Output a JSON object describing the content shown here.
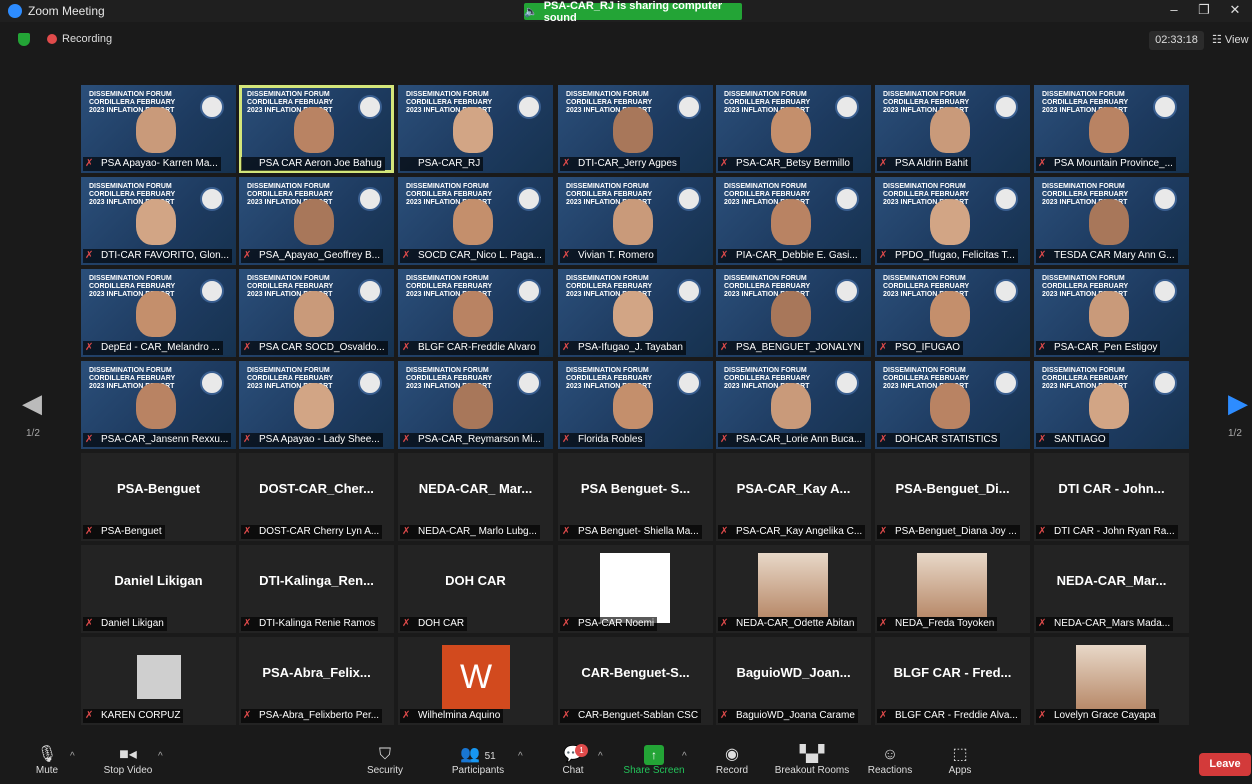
{
  "window": {
    "title": "Zoom Meeting",
    "share_banner": "PSA-CAR_RJ is sharing computer sound"
  },
  "status": {
    "recording": "Recording",
    "timer": "02:33:18",
    "view": "View"
  },
  "pagination": {
    "left": "1/2",
    "right": "1/2"
  },
  "tiles": [
    {
      "name": "PSA Apayao- Karren Ma...",
      "kind": "video",
      "muted": true
    },
    {
      "name": "PSA CAR Aeron Joe Bahug",
      "kind": "video",
      "muted": false,
      "active": true
    },
    {
      "name": "PSA-CAR_RJ",
      "kind": "video",
      "muted": false
    },
    {
      "name": "DTI-CAR_Jerry Agpes",
      "kind": "video",
      "muted": true
    },
    {
      "name": "PSA-CAR_Betsy Bermillo",
      "kind": "video",
      "muted": true
    },
    {
      "name": "PSA Aldrin Bahit",
      "kind": "video",
      "muted": true
    },
    {
      "name": "PSA Mountain Province_...",
      "kind": "video",
      "muted": true
    },
    {
      "name": "DTI-CAR FAVORITO, Glon...",
      "kind": "video",
      "muted": true
    },
    {
      "name": "PSA_Apayao_Geoffrey B...",
      "kind": "video",
      "muted": true
    },
    {
      "name": "SOCD CAR_Nico L. Paga...",
      "kind": "video",
      "muted": true
    },
    {
      "name": "Vivian T. Romero",
      "kind": "video",
      "muted": true
    },
    {
      "name": "PIA-CAR_Debbie E. Gasi...",
      "kind": "video",
      "muted": true
    },
    {
      "name": "PPDO_Ifugao, Felicitas T...",
      "kind": "video",
      "muted": true
    },
    {
      "name": "TESDA CAR Mary Ann G...",
      "kind": "video",
      "muted": true
    },
    {
      "name": "DepEd - CAR_Melandro ...",
      "kind": "video",
      "muted": true
    },
    {
      "name": "PSA CAR SOCD_Osvaldo...",
      "kind": "video",
      "muted": true
    },
    {
      "name": "BLGF CAR-Freddie Alvaro",
      "kind": "video",
      "muted": true
    },
    {
      "name": "PSA-Ifugao_J. Tayaban",
      "kind": "video",
      "muted": true
    },
    {
      "name": "PSA_BENGUET_JONALYN",
      "kind": "video",
      "muted": true
    },
    {
      "name": "PSO_IFUGAO",
      "kind": "video",
      "muted": true
    },
    {
      "name": "PSA-CAR_Pen Estigoy",
      "kind": "video",
      "muted": true
    },
    {
      "name": "PSA-CAR_Jansenn Rexxu...",
      "kind": "video",
      "muted": true
    },
    {
      "name": "PSA Apayao - Lady Shee...",
      "kind": "video",
      "muted": true
    },
    {
      "name": "PSA-CAR_Reymarson Mi...",
      "kind": "video",
      "muted": true
    },
    {
      "name": "Florida Robles",
      "kind": "video",
      "muted": true
    },
    {
      "name": "PSA-CAR_Lorie Ann Buca...",
      "kind": "video",
      "muted": true
    },
    {
      "name": "DOHCAR STATISTICS",
      "kind": "video",
      "muted": true
    },
    {
      "name": "SANTIAGO",
      "kind": "video",
      "muted": true
    },
    {
      "name": "PSA-Benguet",
      "big": "PSA-Benguet",
      "kind": "name",
      "muted": true
    },
    {
      "name": "DOST-CAR Cherry Lyn A...",
      "big": "DOST-CAR_Cher...",
      "kind": "name",
      "muted": true
    },
    {
      "name": "NEDA-CAR_ Marlo Lubg...",
      "big": "NEDA-CAR_ Mar...",
      "kind": "name",
      "muted": true
    },
    {
      "name": "PSA Benguet- Shiella Ma...",
      "big": "PSA Benguet- S...",
      "kind": "name",
      "muted": true
    },
    {
      "name": "PSA-CAR_Kay Angelika C...",
      "big": "PSA-CAR_Kay A...",
      "kind": "name",
      "muted": true
    },
    {
      "name": "PSA-Benguet_Diana Joy ...",
      "big": "PSA-Benguet_Di...",
      "kind": "name",
      "muted": true
    },
    {
      "name": "DTI CAR - John Ryan Ra...",
      "big": "DTI CAR - John...",
      "kind": "name",
      "muted": true
    },
    {
      "name": "Daniel Likigan",
      "big": "Daniel Likigan",
      "kind": "name",
      "muted": true
    },
    {
      "name": "DTI-Kalinga Renie Ramos",
      "big": "DTI-Kalinga_Ren...",
      "kind": "name",
      "muted": true
    },
    {
      "name": "DOH CAR",
      "big": "DOH CAR",
      "kind": "name",
      "muted": true
    },
    {
      "name": "PSA-CAR Noemi",
      "kind": "photo-white",
      "muted": true
    },
    {
      "name": "NEDA-CAR_Odette Abitan",
      "kind": "photo-face",
      "muted": true
    },
    {
      "name": "NEDA_Freda Toyoken",
      "kind": "photo-face",
      "muted": true
    },
    {
      "name": "NEDA-CAR_Mars Mada...",
      "big": "NEDA-CAR_Mar...",
      "kind": "name",
      "muted": true
    },
    {
      "name": "KAREN CORPUZ",
      "kind": "photo-default",
      "muted": true
    },
    {
      "name": "PSA-Abra_Felixberto Per...",
      "big": "PSA-Abra_Felix...",
      "kind": "name",
      "muted": true
    },
    {
      "name": "Wilhelmina Aquino",
      "kind": "letter",
      "letter": "W",
      "muted": true
    },
    {
      "name": "CAR-Benguet-Sablan CSC",
      "big": "CAR-Benguet-S...",
      "kind": "name",
      "muted": true
    },
    {
      "name": "BaguioWD_Joana Carame",
      "big": "BaguioWD_Joan...",
      "kind": "name",
      "muted": true
    },
    {
      "name": "BLGF CAR - Freddie Alva...",
      "big": "BLGF CAR - Fred...",
      "kind": "name",
      "muted": true
    },
    {
      "name": "Lovelyn Grace Cayapa",
      "kind": "photo-face",
      "muted": true
    }
  ],
  "banner_text": "DISSEMINATION FORUM CORDILLERA FEBRUARY 2023 INFLATION REPORT",
  "toolbar": {
    "mute": "Mute",
    "stop_video": "Stop Video",
    "security": "Security",
    "participants": "Participants",
    "participants_count": "51",
    "chat": "Chat",
    "chat_badge": "1",
    "share_screen": "Share Screen",
    "record": "Record",
    "breakout": "Breakout Rooms",
    "reactions": "Reactions",
    "apps": "Apps",
    "leave": "Leave"
  },
  "colors": {
    "accent": "#2d8cff",
    "green": "#23a436",
    "leave": "#d33a3a",
    "active_border": "#d4e67a"
  }
}
